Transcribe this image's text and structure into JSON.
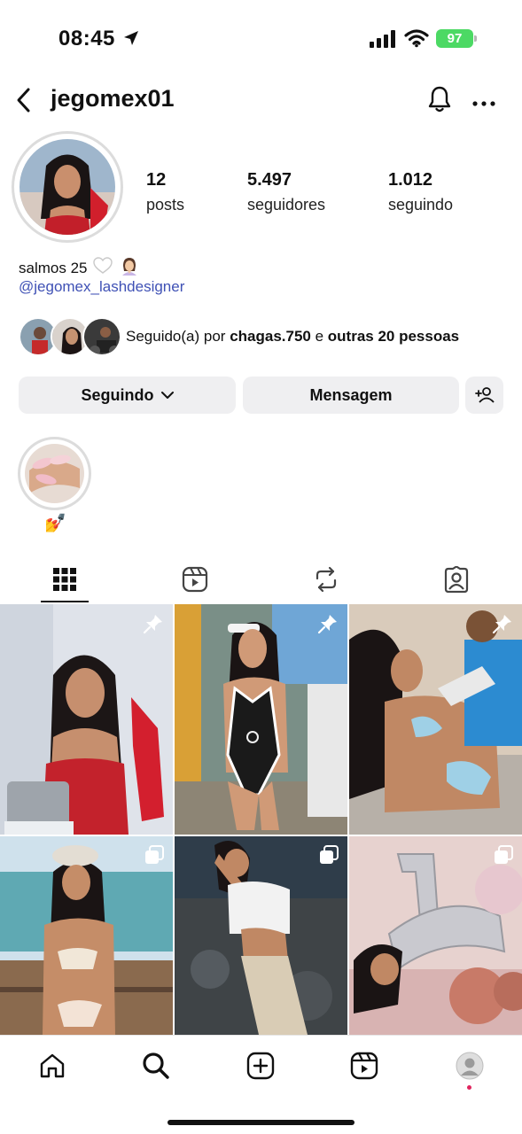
{
  "status_bar": {
    "time": "08:45",
    "battery": "97"
  },
  "header": {
    "username": "jegomex01"
  },
  "profile": {
    "stats": [
      {
        "value": "12",
        "label": "posts"
      },
      {
        "value": "5.497",
        "label": "seguidores"
      },
      {
        "value": "1.012",
        "label": "seguindo"
      }
    ],
    "bio_text": "salmos 25",
    "bio_link": "@jegomex_lashdesigner",
    "followed_by": {
      "prefix": "Seguido(a) por ",
      "user": "chagas.750",
      "middle": " e ",
      "others": "outras 20 pessoas"
    }
  },
  "buttons": {
    "following": "Seguindo",
    "message": "Mensagem"
  },
  "highlight": {
    "label": "💅"
  },
  "tabs": [
    {
      "icon": "grid-icon",
      "selected": true
    },
    {
      "icon": "reels-icon",
      "selected": false
    },
    {
      "icon": "repost-icon",
      "selected": false
    },
    {
      "icon": "tagged-icon",
      "selected": false
    }
  ],
  "posts": [
    {
      "type": "pinned"
    },
    {
      "type": "pinned"
    },
    {
      "type": "pinned"
    },
    {
      "type": "carousel"
    },
    {
      "type": "carousel"
    },
    {
      "type": "carousel"
    }
  ],
  "nav": [
    "home-icon",
    "search-icon",
    "create-icon",
    "reels-icon",
    "profile-icon"
  ],
  "colors": {
    "link": "#3f51b5",
    "battery": "#4cd964",
    "button_bg": "#efeff1",
    "notification_dot": "#e0245e"
  }
}
